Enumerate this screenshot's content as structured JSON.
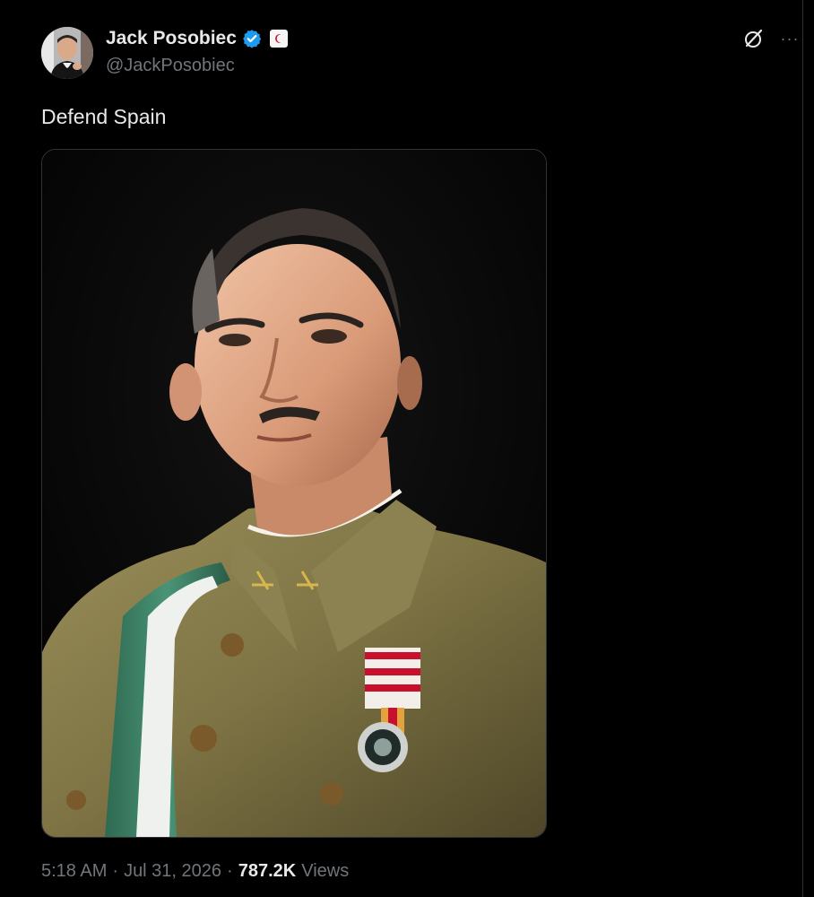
{
  "tweet": {
    "author": {
      "display_name": "Jack Posobiec",
      "handle": "@JackPosobiec",
      "verified": true,
      "verified_color": "#1d9bf0",
      "avatar_icon": "profile-photo"
    },
    "text": "Defend Spain",
    "media": {
      "type": "image",
      "description_icon": "portrait-photo"
    },
    "meta": {
      "time": "5:18 AM",
      "separator": "·",
      "date": "Jul 31, 2026",
      "views_count": "787.2K",
      "views_label": "Views"
    },
    "actions": {
      "grok_icon": "grok-icon",
      "more_icon": "more-icon",
      "more_label": "···"
    }
  },
  "colors": {
    "background": "#000000",
    "text_primary": "#e7e9ea",
    "text_secondary": "#71767b",
    "border": "#2f3336"
  }
}
